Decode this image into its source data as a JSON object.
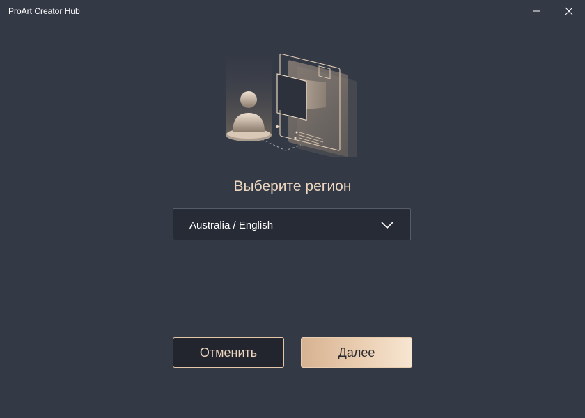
{
  "app": {
    "title": "ProArt Creator Hub"
  },
  "window_controls": {
    "minimize_icon": "minimize-icon",
    "close_icon": "close-icon"
  },
  "region": {
    "heading": "Выберите регион",
    "selected_value": "Australia / English",
    "dropdown_icon": "chevron-down-icon"
  },
  "actions": {
    "cancel_label": "Отменить",
    "next_label": "Далее"
  },
  "colors": {
    "background": "#343946",
    "accent": "#edd6bf",
    "field_background": "#272b35",
    "primary_button_gradient_start": "#d6b291",
    "primary_button_gradient_end": "#f7e5d2"
  }
}
